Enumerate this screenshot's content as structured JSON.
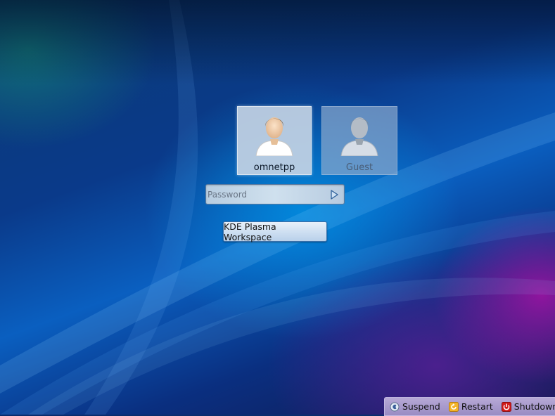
{
  "users": [
    {
      "name": "omnetpp",
      "selected": true
    },
    {
      "name": "Guest",
      "selected": false
    }
  ],
  "login": {
    "password_placeholder": "Password",
    "password_value": ""
  },
  "session": {
    "label": "KDE Plasma Workspace"
  },
  "power": {
    "suspend_label": "Suspend",
    "restart_label": "Restart",
    "shutdown_label": "Shutdown"
  },
  "icons": {
    "user": "user-avatar-icon",
    "login": "login-arrow-icon",
    "suspend": "suspend-icon",
    "restart": "restart-icon",
    "shutdown": "shutdown-icon"
  },
  "colors": {
    "background": "#0a3a8a",
    "accent": "#0a5fc0",
    "shutdown_red": "#d21a1a",
    "restart_orange": "#e8a020"
  }
}
